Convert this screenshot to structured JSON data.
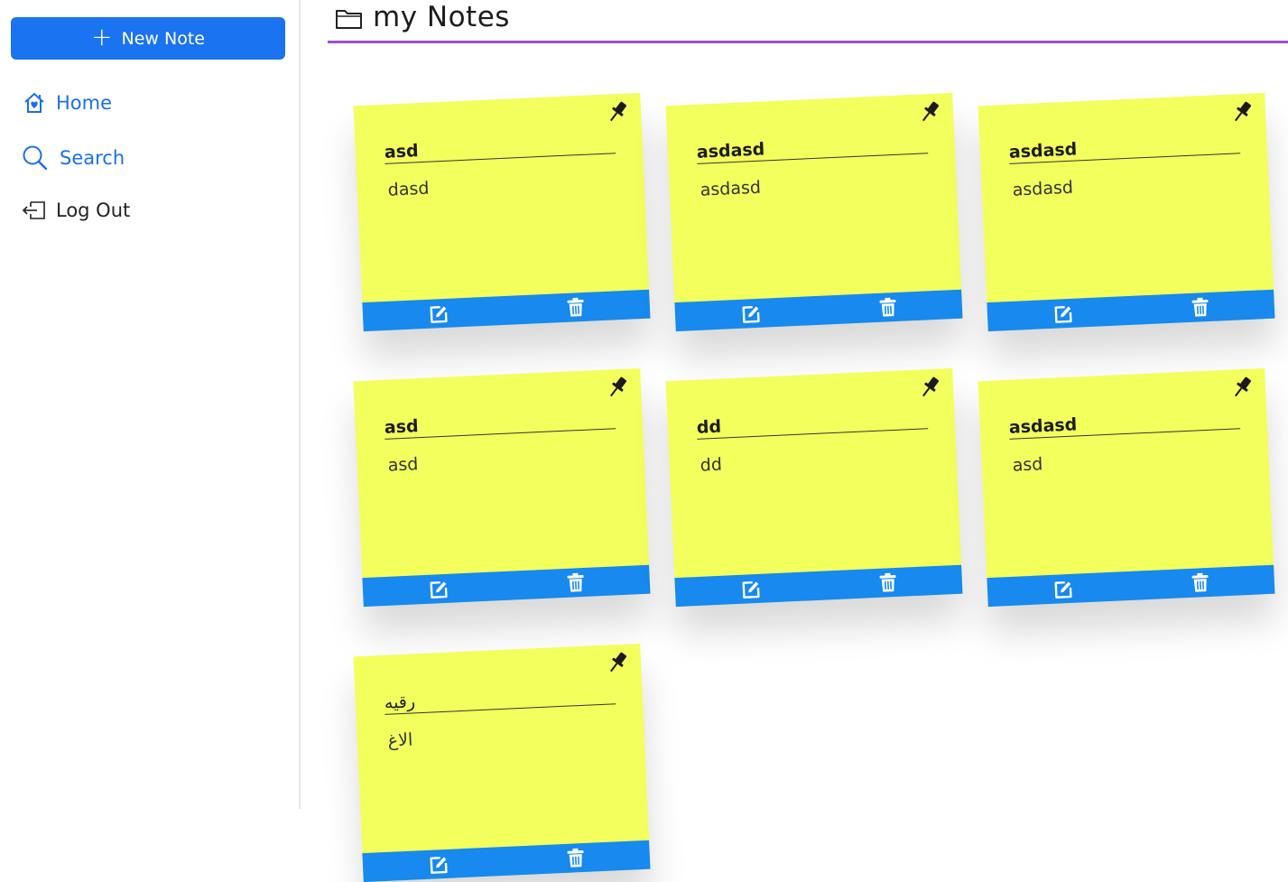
{
  "sidebar": {
    "new_note_label": "New Note",
    "nav": {
      "home": "Home",
      "search": "Search",
      "logout": "Log Out"
    }
  },
  "main": {
    "title": "my Notes"
  },
  "notes": [
    {
      "title": "asd",
      "body": "dasd"
    },
    {
      "title": "asdasd",
      "body": "asdasd"
    },
    {
      "title": "asdasd",
      "body": "asdasd"
    },
    {
      "title": "asd",
      "body": "asd"
    },
    {
      "title": "dd",
      "body": "dd"
    },
    {
      "title": "asdasd",
      "body": "asd"
    },
    {
      "title": "رقيه",
      "body": "الاغ"
    }
  ],
  "colors": {
    "accent_blue": "#1a73f0",
    "note_yellow": "#f2ff5d",
    "note_bar_blue": "#1789ef",
    "header_underline": "#9b4fd6"
  },
  "icons": {
    "plus": "plus-icon",
    "home": "home-heart-icon",
    "search": "search-icon",
    "logout": "logout-icon",
    "folder": "folder-icon",
    "pin": "pushpin-icon",
    "edit": "edit-icon",
    "trash": "trash-icon"
  }
}
